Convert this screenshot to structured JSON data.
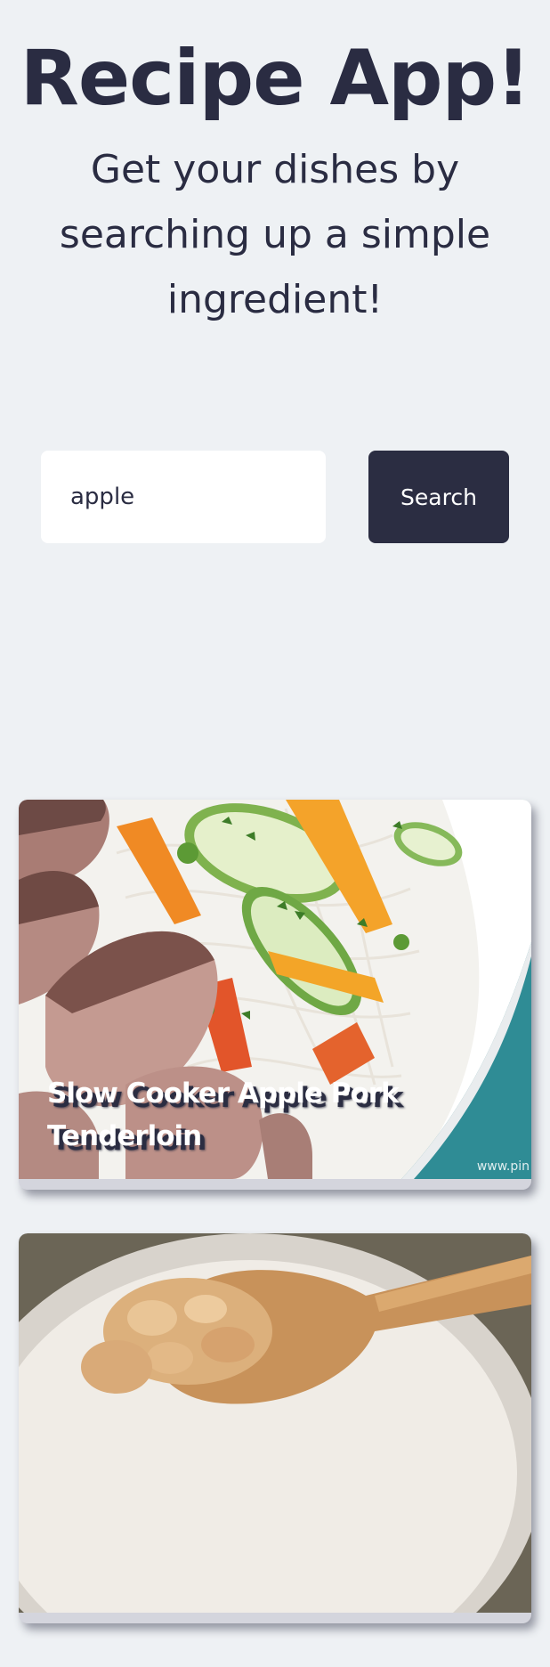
{
  "header": {
    "title": "Recipe App!",
    "subtitle": "Get your dishes by searching up a simple ingredient!"
  },
  "search": {
    "value": "apple",
    "button_label": "Search"
  },
  "results": [
    {
      "title": "Slow Cooker Apple Pork Tenderloin",
      "image_icon": "pork-noodle-salad-photo",
      "watermark": "www.pin"
    },
    {
      "title": "",
      "image_icon": "applesauce-spoon-photo"
    }
  ],
  "colors": {
    "background": "#eef1f4",
    "primary": "#2b2d42",
    "input_background": "#ffffff",
    "text_on_primary": "#ffffff"
  }
}
